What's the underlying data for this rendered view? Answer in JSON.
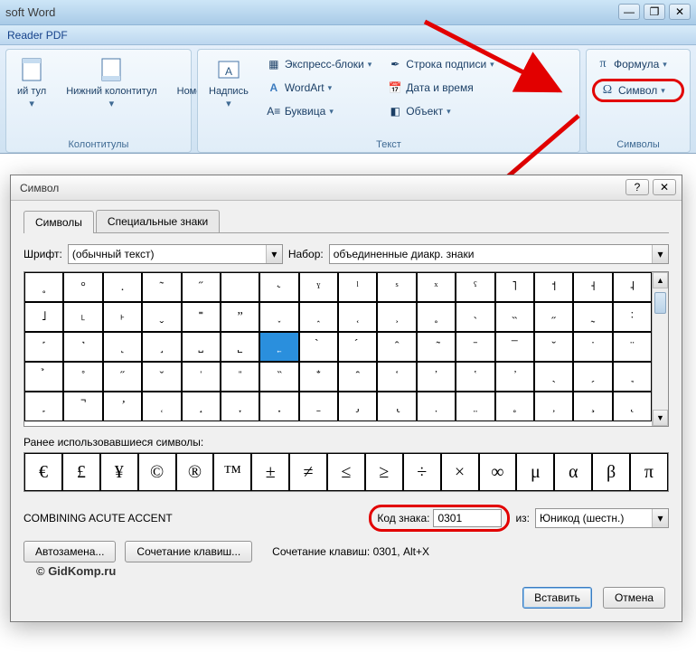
{
  "window": {
    "title": "soft Word"
  },
  "qat": {
    "label": "Reader PDF"
  },
  "ribbon": {
    "groups": {
      "headers_footers": {
        "label": "Колонтитулы",
        "upper": "ий\nтул",
        "lower": "Нижний\nколонтитул",
        "pagenum": "Номер\nстраницы"
      },
      "text": {
        "label": "Текст",
        "caption": "Надпись",
        "express": "Экспресс-блоки",
        "wordart": "WordArt",
        "dropcap": "Буквица",
        "sigline": "Строка подписи",
        "datetime": "Дата и время",
        "object": "Объект"
      },
      "symbols": {
        "label": "Символы",
        "formula": "Формула",
        "symbol": "Символ"
      }
    }
  },
  "dialog": {
    "title": "Символ",
    "tabs": {
      "symbols": "Символы",
      "special": "Специальные знаки"
    },
    "font_lbl": "Шрифт:",
    "font_val": "(обычный текст)",
    "set_lbl": "Набор:",
    "set_val": "объединенные диакр. знаки",
    "recent_lbl": "Ранее использовавшиеся символы:",
    "recent": [
      "€",
      "£",
      "¥",
      "©",
      "®",
      "™",
      "±",
      "≠",
      "≤",
      "≥",
      "÷",
      "×",
      "∞",
      "μ",
      "α",
      "β",
      "π"
    ],
    "charname": "COMBINING ACUTE ACCENT",
    "code_lbl": "Код знака:",
    "code_val": "0301",
    "from_lbl": "из:",
    "from_val": "Юникод (шестн.)",
    "autocorrect": "Автозамена...",
    "shortcut": "Сочетание клавиш...",
    "shortcut_info": "Сочетание клавиш: 0301, Alt+X",
    "insert": "Вставить",
    "cancel": "Отмена"
  },
  "grid_cells": [
    "˳",
    "°",
    ".",
    "˜",
    "˝",
    " ",
    "˞",
    "ˠ",
    "ˡ",
    "ˢ",
    "ˣ",
    "ˤ",
    "˥",
    "˦",
    "˧",
    "˨",
    "˩",
    "˪",
    "˫",
    "ˬ",
    "˭",
    "ˮ",
    "˯",
    "˰",
    "˱",
    "˲",
    "˳",
    "˴",
    "˵",
    "˶",
    "˷",
    "˸",
    "˹",
    "˺",
    "˻",
    "˼",
    "˽",
    "˾",
    "˿",
    "̀",
    "́",
    "̂",
    "̃",
    "̄",
    "̅",
    "̆",
    "̇",
    "̈",
    "̉",
    "̊",
    "̋",
    "̌",
    "̍",
    "̎",
    "̏",
    "̐",
    "̑",
    "̒",
    "̓",
    "̔",
    "̕",
    "̖",
    "̗",
    "̘",
    "̙",
    "̚",
    "̛",
    "̜",
    "̝",
    "̞",
    "̟",
    "̠",
    "̡",
    "̢",
    "̣",
    "̤",
    "̥",
    "̦",
    "̧",
    "̨"
  ],
  "watermark": "© GidKomp.ru"
}
